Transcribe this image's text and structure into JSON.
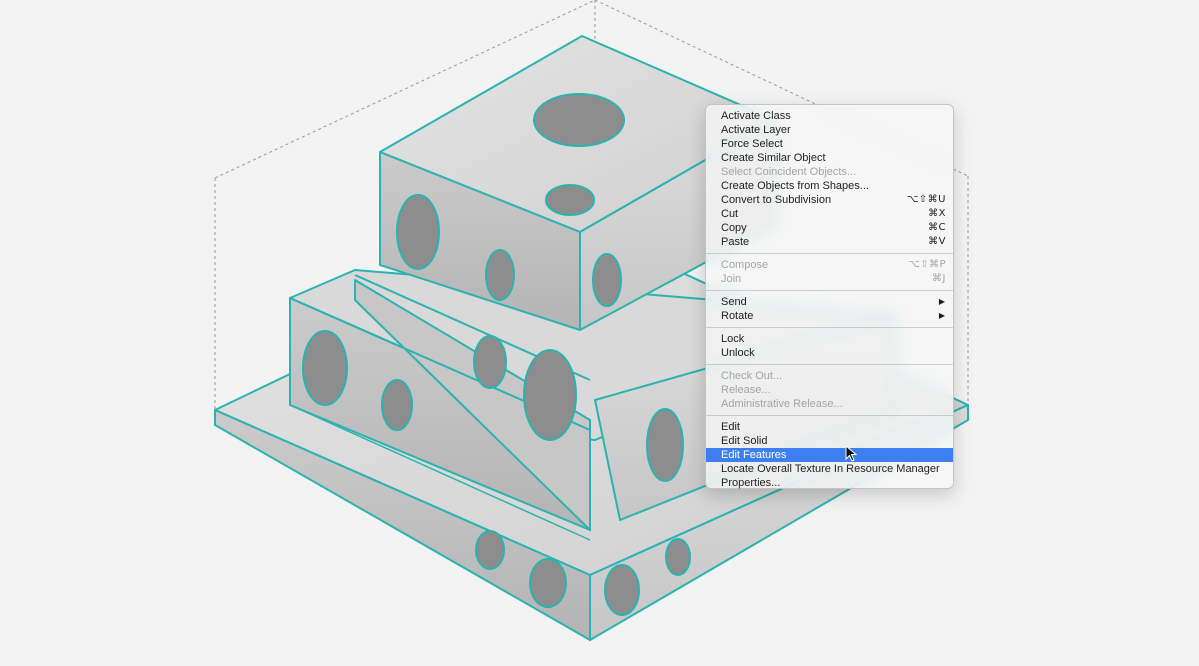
{
  "context_menu": {
    "items": [
      {
        "label": "Activate Class",
        "shortcut": "",
        "disabled": false
      },
      {
        "label": "Activate Layer",
        "shortcut": "",
        "disabled": false
      },
      {
        "label": "Force Select",
        "shortcut": "",
        "disabled": false
      },
      {
        "label": "Create Similar Object",
        "shortcut": "",
        "disabled": false
      },
      {
        "label": "Select Coincident Objects...",
        "shortcut": "",
        "disabled": true
      },
      {
        "label": "Create Objects from Shapes...",
        "shortcut": "",
        "disabled": false
      },
      {
        "label": "Convert to Subdivision",
        "shortcut": "⌥⇧⌘U",
        "disabled": false
      },
      {
        "label": "Cut",
        "shortcut": "⌘X",
        "disabled": false
      },
      {
        "label": "Copy",
        "shortcut": "⌘C",
        "disabled": false
      },
      {
        "label": "Paste",
        "shortcut": "⌘V",
        "disabled": false
      },
      {
        "label": "Compose",
        "shortcut": "⌥⇧⌘P",
        "disabled": true
      },
      {
        "label": "Join",
        "shortcut": "⌘J",
        "disabled": true
      },
      {
        "label": "Send",
        "shortcut": "",
        "disabled": false,
        "submenu": true
      },
      {
        "label": "Rotate",
        "shortcut": "",
        "disabled": false,
        "submenu": true
      },
      {
        "label": "Lock",
        "shortcut": "",
        "disabled": false
      },
      {
        "label": "Unlock",
        "shortcut": "",
        "disabled": false
      },
      {
        "label": "Check Out...",
        "shortcut": "",
        "disabled": true
      },
      {
        "label": "Release...",
        "shortcut": "",
        "disabled": true
      },
      {
        "label": "Administrative Release...",
        "shortcut": "",
        "disabled": true
      },
      {
        "label": "Edit",
        "shortcut": "",
        "disabled": false
      },
      {
        "label": "Edit Solid",
        "shortcut": "",
        "disabled": false
      },
      {
        "label": "Edit Features",
        "shortcut": "",
        "disabled": false,
        "highlighted": true
      },
      {
        "label": "Locate Overall Texture In Resource Manager",
        "shortcut": "",
        "disabled": false
      },
      {
        "label": "Properties...",
        "shortcut": "",
        "disabled": false
      }
    ],
    "submenu_arrow": "▶"
  },
  "colors": {
    "edge_highlight": "#2ab3b0",
    "menu_highlight": "#3d7ff0",
    "background": "#f3f3f3"
  }
}
